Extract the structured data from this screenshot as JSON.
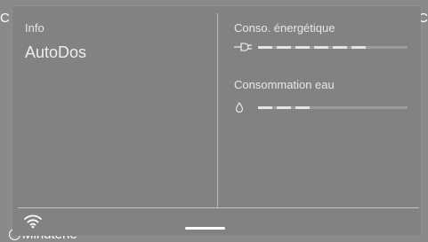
{
  "background": {
    "left_partial_text": "C",
    "right_partial_text": "C",
    "timer_label": "Minuterie"
  },
  "info_panel": {
    "heading": "Info",
    "program_name": "AutoDos"
  },
  "energy": {
    "title": "Conso. énergétique",
    "icon": "plug-icon",
    "segments_total": 8,
    "segments_filled": 6
  },
  "water": {
    "title": "Consommation eau",
    "icon": "water-drop-icon",
    "segments_total": 8,
    "segments_filled": 3
  },
  "status_bar": {
    "wifi_icon": "wifi-icon"
  },
  "colors": {
    "bar_filled": "#e4e4e4",
    "bar_empty": "#9c9c9c"
  }
}
